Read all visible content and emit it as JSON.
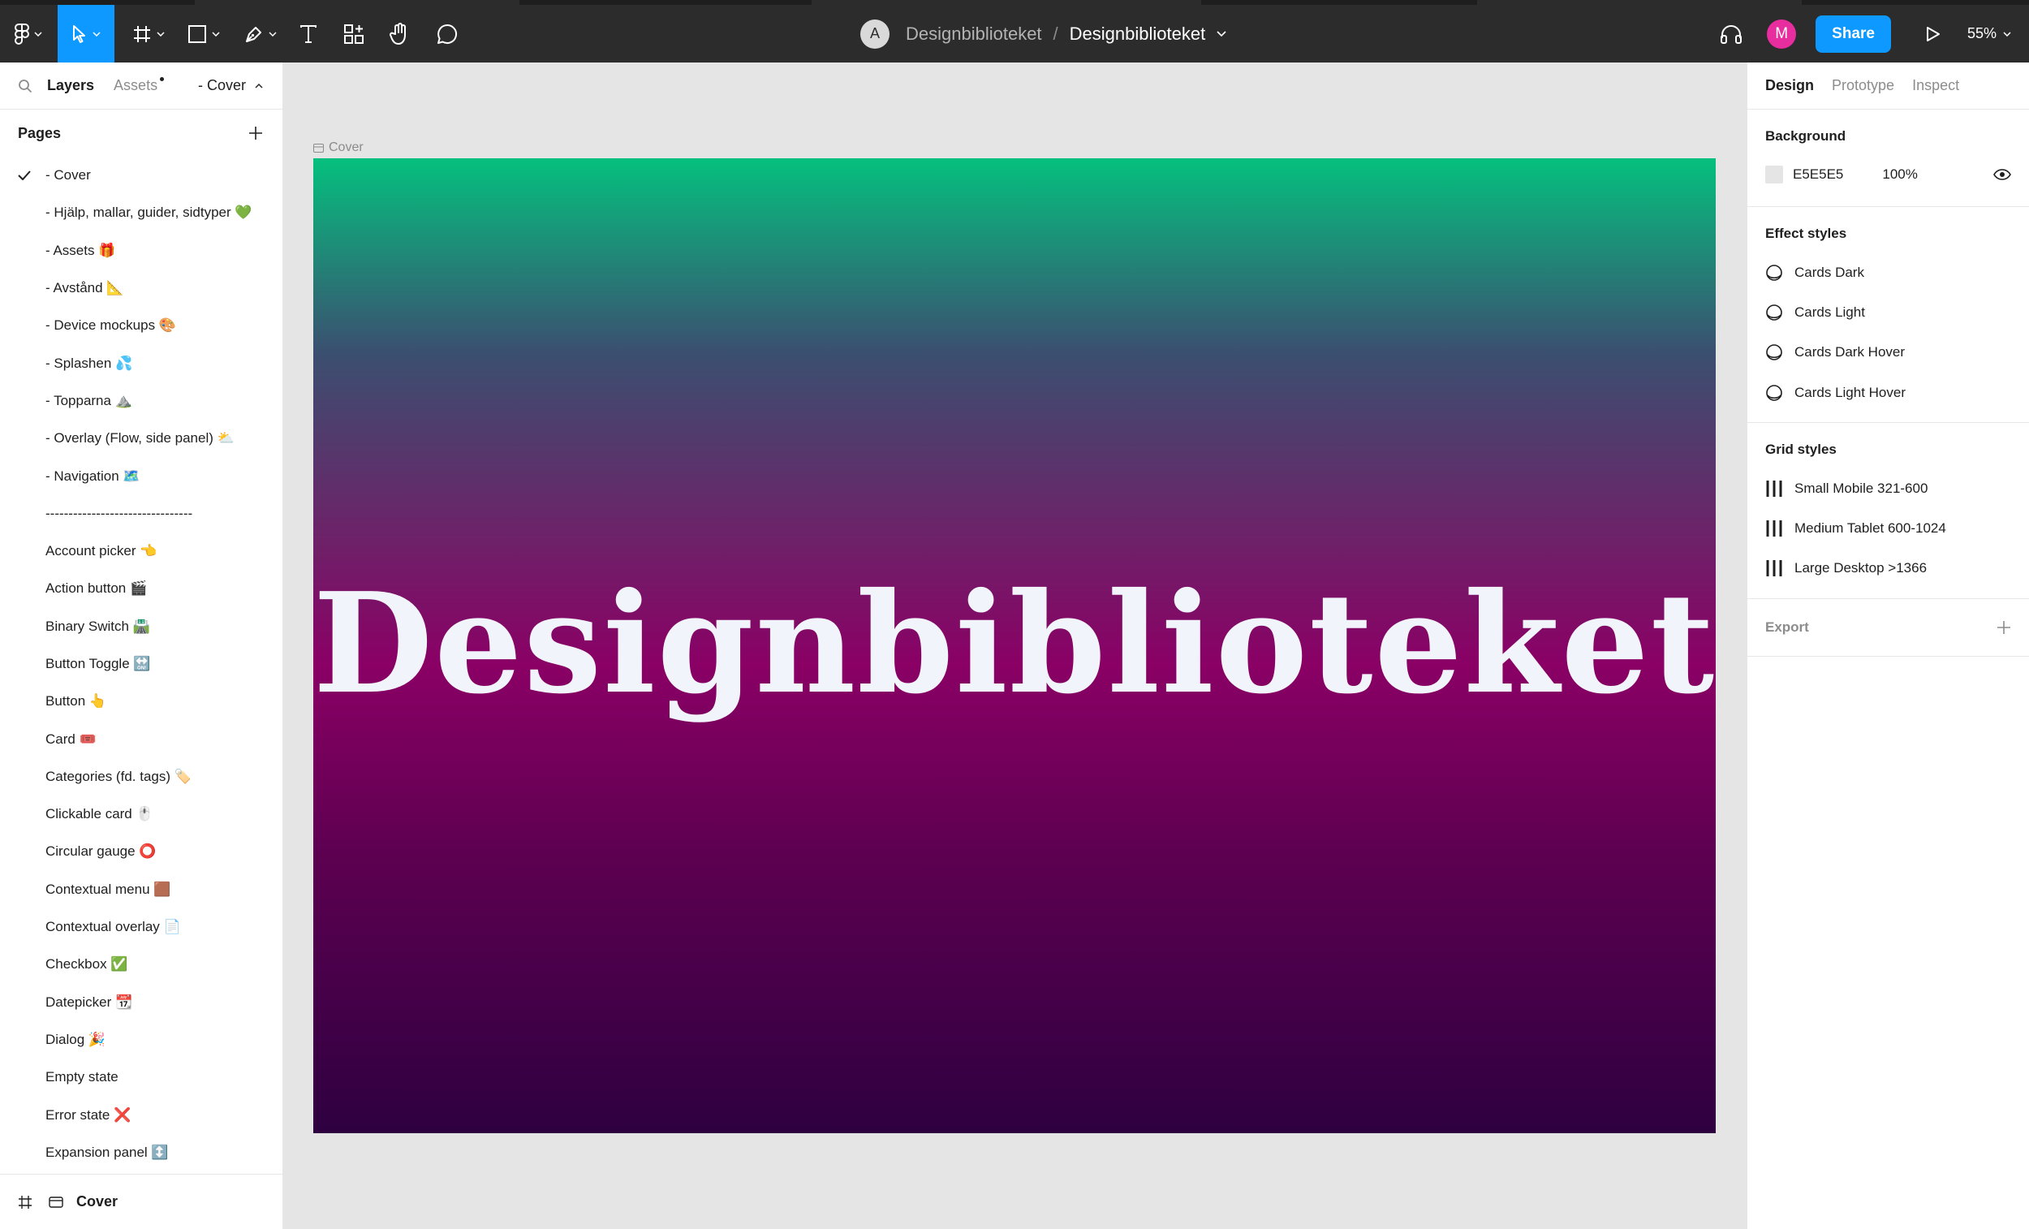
{
  "topbar": {
    "team_avatar": "A",
    "project": "Designbiblioteket",
    "separator": "/",
    "file": "Designbiblioteket",
    "user_avatar": "M",
    "share_label": "Share",
    "zoom": "55%",
    "icons": [
      "figma-menu-icon",
      "move-tool-icon",
      "frame-tool-icon",
      "shape-tool-icon",
      "pen-tool-icon",
      "text-tool-icon",
      "resources-icon",
      "hand-tool-icon",
      "comment-icon",
      "headphones-icon",
      "present-icon"
    ]
  },
  "left_panel": {
    "tabs": {
      "layers": "Layers",
      "assets": "Assets"
    },
    "current_page": "- Cover",
    "pages_title": "Pages",
    "pages": [
      "- Cover",
      "- Hjälp, mallar, guider, sidtyper 💚",
      "- Assets 🎁",
      "- Avstånd 📐",
      "-  Device mockups 🎨",
      "- Splashen 💦",
      "- Topparna ⛰️",
      "- Overlay (Flow, side panel) ⛅",
      "- Navigation 🗺️",
      "--------------------------------",
      "Account picker 👈",
      "Action button 🎬",
      "Binary Switch 🛣️",
      "Button Toggle 🔛",
      "Button 👆",
      "Card 🎟️",
      "Categories (fd. tags) 🏷️",
      "Clickable card 🖱️",
      "Circular gauge ⭕",
      "Contextual menu 🟫",
      "Contextual overlay 📄",
      "Checkbox ✅",
      "Datepicker 📆",
      "Dialog 🎉",
      "Empty state",
      "Error state ❌",
      "Expansion panel ↕️"
    ],
    "footer_label": "Cover"
  },
  "canvas": {
    "frame_label": "Cover",
    "cover_title": "Designbiblioteket",
    "help_label": "?",
    "gradient_colors": [
      "#05c07e",
      "#3b4f70",
      "#8a0065",
      "#2e0040"
    ]
  },
  "right_panel": {
    "tabs": [
      "Design",
      "Prototype",
      "Inspect"
    ],
    "background": {
      "title": "Background",
      "hex": "E5E5E5",
      "opacity": "100%",
      "color": "#e5e5e5"
    },
    "effect_styles": {
      "title": "Effect styles",
      "items": [
        "Cards Dark",
        "Cards Light",
        "Cards Dark Hover",
        "Cards Light Hover"
      ]
    },
    "grid_styles": {
      "title": "Grid styles",
      "items": [
        "Small Mobile 321-600",
        "Medium Tablet 600-1024",
        "Large Desktop >1366"
      ]
    },
    "export": {
      "title": "Export"
    }
  },
  "colors": {
    "accent": "#0d99ff",
    "toolbar": "#2c2c2c",
    "user_avatar": "#e82d9e"
  }
}
